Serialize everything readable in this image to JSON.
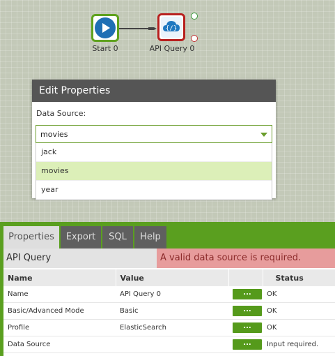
{
  "canvas": {
    "nodes": [
      {
        "label": "Start 0",
        "icon": "play-icon",
        "border_color": "#5fa21e"
      },
      {
        "label": "API Query 0",
        "icon": "cloud-api-icon",
        "border_color": "#b8201f"
      }
    ]
  },
  "dialog": {
    "title": "Edit Properties",
    "data_source_label": "Data Source:",
    "selected_value": "movies",
    "options": [
      "jack",
      "movies",
      "year"
    ]
  },
  "panel": {
    "tabs": [
      "Properties",
      "Export",
      "SQL",
      "Help"
    ],
    "active_tab": "Properties",
    "title": "API Query",
    "error": "A valid data source is required.",
    "columns": [
      "Name",
      "Value",
      "",
      "Status"
    ],
    "edit_button_label": "...",
    "rows": [
      {
        "name": "Name",
        "value": "API Query 0",
        "status": "OK",
        "status_type": "ok"
      },
      {
        "name": "Basic/Advanced Mode",
        "value": "Basic",
        "status": "OK",
        "status_type": "ok"
      },
      {
        "name": "Profile",
        "value": "ElasticSearch",
        "status": "OK",
        "status_type": "ok"
      },
      {
        "name": "Data Source",
        "value": "",
        "status": "Input required.",
        "status_type": "error"
      }
    ]
  },
  "colors": {
    "accent": "#5a9f1f",
    "error_bg": "#e79c9c",
    "selected_option": "#dcefb8"
  }
}
